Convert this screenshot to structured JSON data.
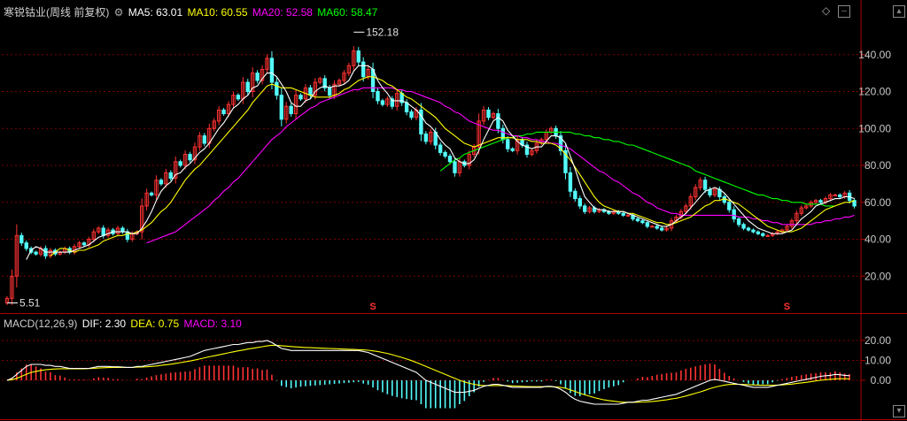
{
  "header": {
    "title": "寒锐钴业(周线 前复权)",
    "ma5_label": "MA5: 63.01",
    "ma10_label": "MA10: 60.55",
    "ma20_label": "MA20: 52.58",
    "ma60_label": "MA60: 58.47",
    "ma5_color": "#ffffff",
    "ma10_color": "#ffff00",
    "ma20_color": "#ff00ff",
    "ma60_color": "#00ff00"
  },
  "macd_header": {
    "title": "MACD(12,26,9)",
    "dif_label": "DIF: 2.30",
    "dea_label": "DEA: 0.75",
    "macd_label": "MACD: 3.10"
  },
  "chart_data": [
    {
      "type": "candlestick",
      "title": "寒锐钴业(周线 前复权)",
      "ylim": [
        0,
        160
      ],
      "y_ticks": [
        "20.00",
        "40.00",
        "60.00",
        "80.00",
        "100.00",
        "120.00",
        "140.00"
      ],
      "y_tick_values": [
        20,
        40,
        60,
        80,
        100,
        120,
        140
      ],
      "annotations": [
        {
          "text": "152.18",
          "bar": 72,
          "value": 152.18
        },
        {
          "text": "5.51",
          "bar": 0,
          "value": 5.51
        }
      ],
      "markers": [
        {
          "text": "S",
          "bar": 76
        },
        {
          "text": "S",
          "bar": 162
        }
      ],
      "up_color": "#ff3232",
      "down_color": "#54fcfc",
      "close": [
        8,
        20,
        42,
        38,
        35,
        33,
        32,
        35,
        31,
        34,
        32,
        33,
        35,
        33,
        36,
        38,
        37,
        40,
        44,
        46,
        42,
        45,
        43,
        46,
        44,
        40,
        43,
        44,
        58,
        65,
        64,
        72,
        70,
        76,
        73,
        82,
        80,
        86,
        83,
        90,
        96,
        92,
        100,
        104,
        110,
        108,
        113,
        118,
        116,
        125,
        120,
        130,
        126,
        132,
        138,
        125,
        118,
        105,
        112,
        108,
        118,
        116,
        122,
        118,
        125,
        127,
        122,
        118,
        124,
        126,
        130,
        134,
        142,
        136,
        128,
        132,
        120,
        115,
        113,
        116,
        112,
        119,
        114,
        109,
        106,
        110,
        97,
        93,
        98,
        91,
        87,
        85,
        82,
        76,
        82,
        80,
        86,
        90,
        104,
        110,
        106,
        108,
        100,
        94,
        89,
        88,
        94,
        91,
        86,
        88,
        92,
        94,
        98,
        100,
        96,
        88,
        76,
        66,
        62,
        58,
        55,
        57,
        55,
        56,
        55,
        54,
        55,
        54,
        53,
        53,
        51,
        50,
        49,
        47,
        47,
        46,
        45,
        46,
        50,
        52,
        55,
        58,
        63,
        68,
        72,
        67,
        64,
        67,
        63,
        60,
        56,
        51,
        48,
        46,
        45,
        44,
        43,
        42,
        42,
        43,
        44,
        45,
        47,
        50,
        54,
        57,
        58,
        60,
        61,
        60,
        62,
        64,
        64,
        63,
        65,
        61,
        58
      ],
      "ma5": [
        null,
        null,
        null,
        null,
        29,
        34,
        36,
        35,
        33,
        33,
        33,
        33,
        33,
        33,
        34,
        35,
        36,
        37,
        39,
        41,
        42,
        43,
        44,
        44,
        44,
        44,
        43,
        43,
        46,
        50,
        55,
        61,
        66,
        69,
        71,
        75,
        76,
        79,
        81,
        84,
        87,
        89,
        92,
        96,
        100,
        103,
        107,
        111,
        113,
        116,
        118,
        122,
        123,
        127,
        130,
        130,
        128,
        124,
        120,
        114,
        112,
        112,
        115,
        116,
        120,
        122,
        123,
        122,
        123,
        123,
        124,
        126,
        131,
        134,
        134,
        134,
        132,
        126,
        122,
        119,
        115,
        115,
        115,
        114,
        112,
        110,
        107,
        103,
        101,
        98,
        94,
        91,
        89,
        84,
        82,
        81,
        81,
        83,
        88,
        94,
        99,
        104,
        106,
        104,
        99,
        96,
        93,
        91,
        90,
        89,
        90,
        90,
        93,
        96,
        96,
        95,
        92,
        85,
        78,
        70,
        63,
        60,
        57,
        56,
        56,
        55,
        55,
        55,
        55,
        54,
        53,
        52,
        51,
        50,
        49,
        48,
        47,
        47,
        48,
        50,
        52,
        54,
        57,
        60,
        63,
        66,
        67,
        68,
        67,
        65,
        62,
        59,
        56,
        53,
        50,
        48,
        46,
        45,
        44,
        43,
        43,
        43,
        44,
        45,
        48,
        51,
        53,
        55,
        58,
        59,
        60,
        61,
        62,
        62,
        63,
        63,
        62
      ],
      "ma10": [
        null,
        null,
        null,
        null,
        null,
        null,
        null,
        null,
        null,
        31,
        33,
        35,
        35,
        34,
        33,
        34,
        34,
        35,
        36,
        37,
        39,
        40,
        41,
        42,
        42,
        43,
        43,
        44,
        45,
        47,
        49,
        52,
        55,
        57,
        60,
        64,
        68,
        72,
        75,
        78,
        80,
        83,
        86,
        89,
        92,
        95,
        98,
        101,
        104,
        107,
        110,
        114,
        117,
        120,
        123,
        124,
        123,
        122,
        122,
        122,
        121,
        120,
        119,
        118,
        117,
        117,
        117,
        117,
        118,
        119,
        121,
        122,
        124,
        126,
        127,
        128,
        128,
        127,
        126,
        124,
        123,
        121,
        119,
        117,
        116,
        114,
        112,
        110,
        108,
        106,
        103,
        100,
        98,
        96,
        94,
        92,
        91,
        90,
        91,
        92,
        93,
        94,
        95,
        95,
        95,
        95,
        94,
        94,
        94,
        93,
        93,
        92,
        92,
        92,
        91,
        89,
        86,
        83,
        79,
        75,
        71,
        67,
        63,
        60,
        58,
        57,
        56,
        55,
        55,
        54,
        54,
        53,
        52,
        51,
        50,
        49,
        49,
        48,
        48,
        49,
        50,
        51,
        52,
        54,
        56,
        58,
        59,
        61,
        61,
        62,
        61,
        60,
        59,
        57,
        55,
        53,
        51,
        49,
        47,
        46,
        45,
        44,
        44,
        44,
        45,
        46,
        48,
        50,
        52,
        54,
        56,
        57,
        58,
        59,
        60,
        60,
        61
      ],
      "ma20": [
        null,
        null,
        null,
        null,
        null,
        null,
        null,
        null,
        null,
        null,
        null,
        null,
        null,
        null,
        null,
        null,
        null,
        null,
        null,
        null,
        null,
        null,
        null,
        null,
        null,
        null,
        null,
        null,
        null,
        38,
        39,
        40,
        41,
        42,
        43,
        44,
        46,
        48,
        50,
        52,
        54,
        56,
        58,
        61,
        63,
        66,
        68,
        71,
        73,
        76,
        79,
        82,
        85,
        88,
        91,
        94,
        96,
        98,
        101,
        103,
        105,
        107,
        109,
        111,
        112,
        114,
        115,
        116,
        117,
        118,
        119,
        120,
        121,
        121,
        122,
        122,
        122,
        122,
        122,
        122,
        122,
        121,
        121,
        120,
        120,
        119,
        118,
        117,
        116,
        115,
        114,
        112,
        111,
        109,
        108,
        106,
        104,
        103,
        102,
        101,
        100,
        99,
        99,
        98,
        97,
        96,
        96,
        95,
        95,
        94,
        94,
        93,
        93,
        92,
        92,
        91,
        90,
        89,
        87,
        85,
        83,
        81,
        79,
        77,
        76,
        74,
        72,
        71,
        69,
        67,
        65,
        64,
        62,
        60,
        59,
        57,
        56,
        55,
        54,
        54,
        53,
        53,
        53,
        53,
        53,
        53,
        53,
        53,
        53,
        53,
        53,
        53,
        52,
        52,
        52,
        51,
        51,
        50,
        50,
        49,
        49,
        48,
        48,
        48,
        48,
        48,
        48,
        48,
        49,
        49,
        50,
        50,
        51,
        51,
        52,
        52,
        53
      ],
      "ma60": [
        null,
        null,
        null,
        null,
        null,
        null,
        null,
        null,
        null,
        null,
        null,
        null,
        null,
        null,
        null,
        null,
        null,
        null,
        null,
        null,
        null,
        null,
        null,
        null,
        null,
        null,
        null,
        null,
        null,
        null,
        null,
        null,
        null,
        null,
        null,
        null,
        null,
        null,
        null,
        null,
        null,
        null,
        null,
        null,
        null,
        null,
        null,
        null,
        null,
        null,
        null,
        null,
        null,
        null,
        null,
        null,
        null,
        null,
        null,
        null,
        null,
        null,
        null,
        null,
        null,
        null,
        null,
        null,
        null,
        null,
        null,
        null,
        null,
        null,
        null,
        null,
        null,
        null,
        null,
        null,
        null,
        null,
        null,
        null,
        null,
        null,
        null,
        null,
        null,
        null,
        77,
        79,
        81,
        83,
        84,
        86,
        87,
        88,
        89,
        90,
        91,
        92,
        93,
        94,
        95,
        95,
        96,
        96,
        97,
        97,
        98,
        98,
        98,
        98,
        98,
        98,
        98,
        98,
        97,
        97,
        96,
        96,
        95,
        95,
        94,
        94,
        93,
        93,
        92,
        91,
        91,
        90,
        89,
        88,
        87,
        86,
        85,
        84,
        83,
        82,
        81,
        80,
        79,
        77,
        76,
        75,
        74,
        73,
        72,
        71,
        70,
        69,
        68,
        67,
        66,
        65,
        64,
        64,
        63,
        62,
        62,
        61,
        61,
        60,
        60,
        60,
        59,
        59,
        59,
        59,
        58,
        58,
        58
      ]
    },
    {
      "type": "macd",
      "title": "MACD(12,26,9)",
      "ylim": [
        -16,
        24
      ],
      "y_ticks": [
        "0.00",
        "10.00",
        "20.00"
      ],
      "y_tick_values": [
        0,
        10,
        20
      ],
      "dif": [
        0,
        1,
        3,
        5,
        7,
        8,
        8,
        8,
        7.5,
        7.5,
        7,
        7,
        6.5,
        6,
        6,
        6,
        6,
        6,
        6.5,
        7,
        7,
        7,
        6.8,
        6.8,
        6.6,
        6.5,
        6.5,
        7,
        7,
        7.5,
        8,
        8.5,
        9,
        9.5,
        10,
        10.5,
        11,
        11.5,
        12,
        13,
        14,
        15,
        15.5,
        16,
        16.5,
        17,
        17.5,
        18,
        18,
        18.5,
        19,
        19,
        19.5,
        19.5,
        20,
        19,
        17.5,
        16,
        15.5,
        15,
        15,
        15,
        15,
        15,
        15,
        15,
        15,
        15,
        15,
        15,
        15,
        15,
        15,
        15,
        14.5,
        14,
        13,
        12,
        11,
        10,
        9,
        8,
        7,
        6,
        5,
        4,
        2,
        0,
        -1,
        -2,
        -3,
        -4,
        -5,
        -6,
        -6,
        -6,
        -5.5,
        -5,
        -4,
        -3,
        -2.5,
        -2,
        -2,
        -2.5,
        -3,
        -3.5,
        -3.5,
        -3.5,
        -3.5,
        -3.5,
        -3.5,
        -3.5,
        -3,
        -3,
        -3.5,
        -4.5,
        -6,
        -8,
        -9.5,
        -10.5,
        -11,
        -11.5,
        -12,
        -12,
        -12,
        -12,
        -12,
        -12,
        -11.5,
        -11,
        -11,
        -10.5,
        -10,
        -10,
        -9.5,
        -9,
        -8.5,
        -8,
        -7.5,
        -7,
        -6,
        -5,
        -4,
        -3,
        -2,
        -1,
        0,
        0.5,
        0,
        -0.5,
        -1,
        -1.5,
        -2,
        -2.5,
        -3,
        -3.5,
        -3.5,
        -3.5,
        -3.5,
        -3,
        -2.5,
        -2,
        -1.5,
        -1,
        -0.5,
        0,
        0.5,
        1,
        1.5,
        2,
        2.3,
        2.5,
        3,
        2.8,
        2.5,
        2.3
      ],
      "dea": [
        0,
        0.3,
        1,
        2,
        3,
        4,
        4.5,
        5,
        5.3,
        5.5,
        5.7,
        5.8,
        5.8,
        5.8,
        5.8,
        5.8,
        5.8,
        5.9,
        6,
        6.2,
        6.3,
        6.4,
        6.5,
        6.5,
        6.5,
        6.5,
        6.5,
        6.6,
        6.7,
        6.8,
        7,
        7.2,
        7.5,
        7.8,
        8.1,
        8.5,
        8.9,
        9.3,
        9.7,
        10.2,
        10.7,
        11.3,
        11.8,
        12.3,
        12.8,
        13.3,
        13.8,
        14.3,
        14.8,
        15.2,
        15.7,
        16.1,
        16.5,
        16.9,
        17.3,
        17.6,
        17.6,
        17.4,
        17.2,
        17,
        16.8,
        16.6,
        16.5,
        16.4,
        16.3,
        16.2,
        16.1,
        16,
        15.9,
        15.8,
        15.7,
        15.6,
        15.5,
        15.4,
        15.3,
        15.1,
        14.8,
        14.5,
        14,
        13.5,
        12.9,
        12.2,
        11.5,
        10.7,
        9.9,
        9,
        8,
        7,
        6,
        5,
        4,
        3,
        2,
        1,
        0,
        -0.8,
        -1.5,
        -2,
        -2.4,
        -2.6,
        -2.6,
        -2.6,
        -2.6,
        -2.6,
        -2.7,
        -2.8,
        -2.9,
        -3,
        -3.1,
        -3.2,
        -3.2,
        -3.2,
        -3.2,
        -3.2,
        -3.3,
        -3.5,
        -4,
        -4.8,
        -5.6,
        -6.5,
        -7.3,
        -8,
        -8.7,
        -9.3,
        -9.8,
        -10.2,
        -10.5,
        -10.8,
        -11,
        -11,
        -11,
        -11,
        -10.9,
        -10.8,
        -10.6,
        -10.4,
        -10.1,
        -9.8,
        -9.4,
        -9,
        -8.5,
        -7.9,
        -7.2,
        -6.5,
        -5.8,
        -5,
        -4.2,
        -3.5,
        -2.9,
        -2.4,
        -2.1,
        -2,
        -2,
        -2.1,
        -2.2,
        -2.3,
        -2.4,
        -2.5,
        -2.5,
        -2.5,
        -2.4,
        -2.3,
        -2.1,
        -1.9,
        -1.6,
        -1.3,
        -1,
        -0.7,
        -0.3,
        0,
        0.3,
        0.5,
        0.7,
        0.8,
        0.8,
        0.75
      ],
      "dif_color": "#ffffff",
      "dea_color": "#ffff00",
      "hist_pos_color": "#ff3232",
      "hist_neg_color": "#54fcfc"
    }
  ]
}
